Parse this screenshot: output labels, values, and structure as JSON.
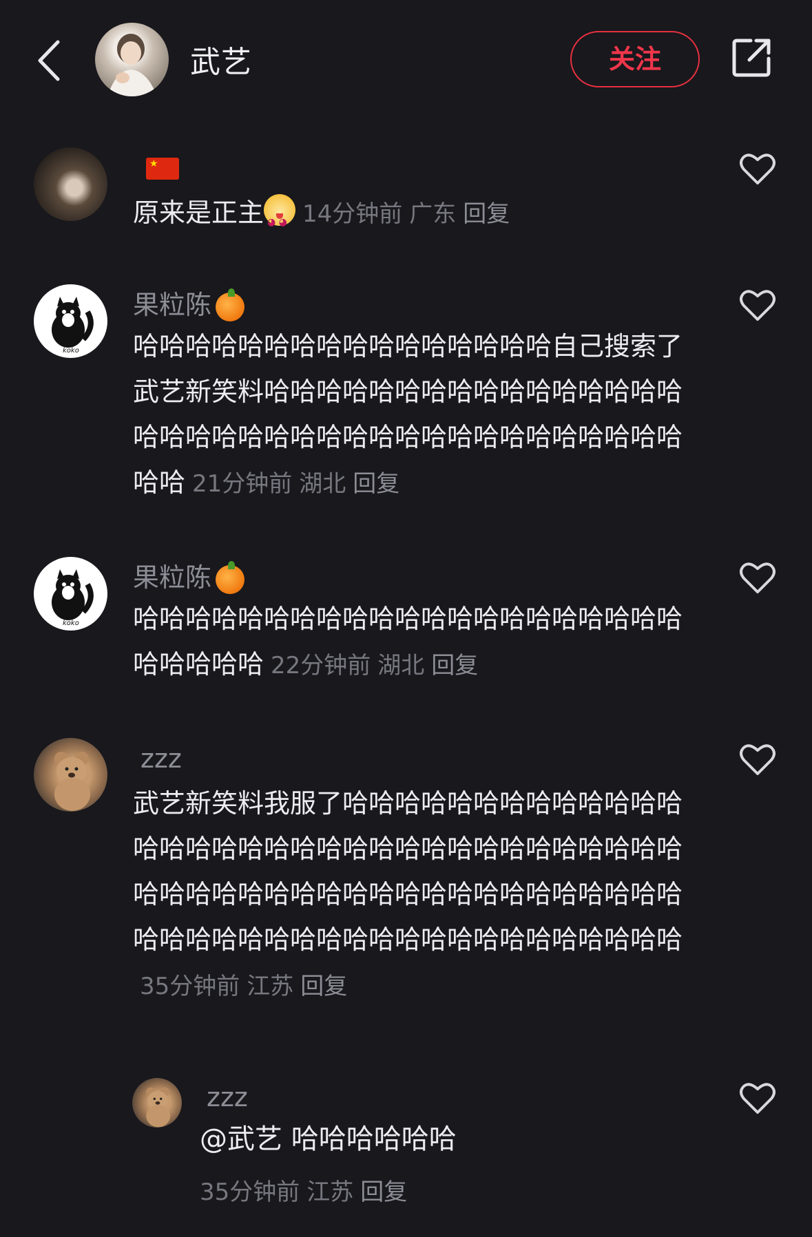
{
  "header": {
    "title": "武艺",
    "follow_label": "关注"
  },
  "comments": [
    {
      "name": "",
      "text": "原来是正主",
      "time": "14分钟前",
      "location": "广东",
      "reply_label": "回复"
    },
    {
      "name": "果粒陈",
      "text": "哈哈哈哈哈哈哈哈哈哈哈哈哈哈哈哈自己搜索了武艺新笑料哈哈哈哈哈哈哈哈哈哈哈哈哈哈哈哈哈哈哈哈哈哈哈哈哈哈哈哈哈哈哈哈哈哈哈哈哈哈哈",
      "time": "21分钟前",
      "location": "湖北",
      "reply_label": "回复"
    },
    {
      "name": "果粒陈",
      "text": "哈哈哈哈哈哈哈哈哈哈哈哈哈哈哈哈哈哈哈哈哈哈哈哈哈哈",
      "time": "22分钟前",
      "location": "湖北",
      "reply_label": "回复"
    },
    {
      "name": "zzz",
      "text": "武艺新笑料我服了哈哈哈哈哈哈哈哈哈哈哈哈哈哈哈哈哈哈哈哈哈哈哈哈哈哈哈哈哈哈哈哈哈哈哈哈哈哈哈哈哈哈哈哈哈哈哈哈哈哈哈哈哈哈哈哈哈哈哈哈哈哈哈哈哈哈哈哈哈哈哈哈哈哈哈哈",
      "time": "35分钟前",
      "location": "江苏",
      "reply_label": "回复"
    }
  ],
  "sub_reply": {
    "name": "zzz",
    "mention": "@武艺",
    "text": "哈哈哈哈哈哈",
    "time": "35分钟前",
    "location": "江苏",
    "reply_label": "回复"
  },
  "icons": {
    "back": "chevron-left-icon",
    "share": "share-icon",
    "like": "heart-icon",
    "flag": "china-flag-emoji",
    "orange": "orange-emoji",
    "face": "cute-face-emoji"
  }
}
